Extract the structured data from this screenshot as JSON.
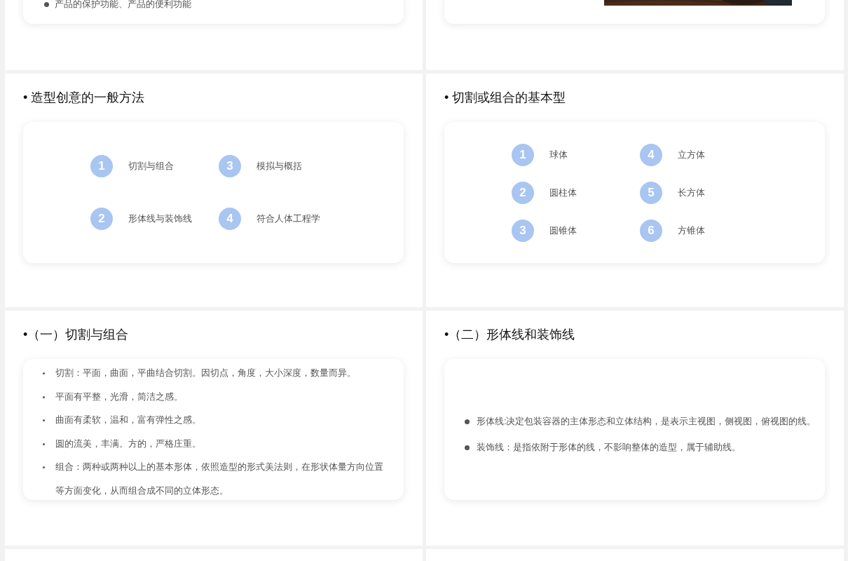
{
  "slides": [
    {
      "kind": "bullets_top",
      "bullets": [
        "产品的保护功能、产品的便利功能"
      ]
    },
    {
      "kind": "picture_top"
    },
    {
      "kind": "numbered",
      "title": "• 造型创意的一般方法",
      "items": [
        {
          "number": "1",
          "label": "切割与组合"
        },
        {
          "number": "2",
          "label": "形体线与装饰线"
        },
        {
          "number": "3",
          "label": "模拟与概括"
        },
        {
          "number": "4",
          "label": "符合人体工程学"
        }
      ]
    },
    {
      "kind": "numbered",
      "title": "• 切割或组合的基本型",
      "items": [
        {
          "number": "1",
          "label": "球体"
        },
        {
          "number": "2",
          "label": "圆柱体"
        },
        {
          "number": "3",
          "label": "圆锥体"
        },
        {
          "number": "4",
          "label": "立方体"
        },
        {
          "number": "5",
          "label": "长方体"
        },
        {
          "number": "6",
          "label": "方锥体"
        }
      ]
    },
    {
      "kind": "list_small",
      "title": "•（一）切割与组合",
      "bullets": [
        "切割：平面，曲面，平曲结合切割。因切点，角度，大小深度，数量而异。",
        "平面有平整，光滑，简洁之感。",
        "曲面有柔软，温和，富有弹性之感。",
        "圆的流美，丰满。方的，严格庄重。",
        "组合：两种或两种以上的基本形体，依照造型的形式美法则，在形状体量方向位置等方面变化，从而组合成不同的立体形态。"
      ]
    },
    {
      "kind": "list_large",
      "title": "•（二）形体线和装饰线",
      "bullets": [
        "形体线:决定包装容器的主体形态和立体结构，是表示主视图，侧视图，俯视图的线。",
        "装饰线：是指依附于形体的线，不影响整体的造型，属于辅助线。"
      ]
    },
    {
      "kind": "blank"
    },
    {
      "kind": "blank"
    }
  ]
}
